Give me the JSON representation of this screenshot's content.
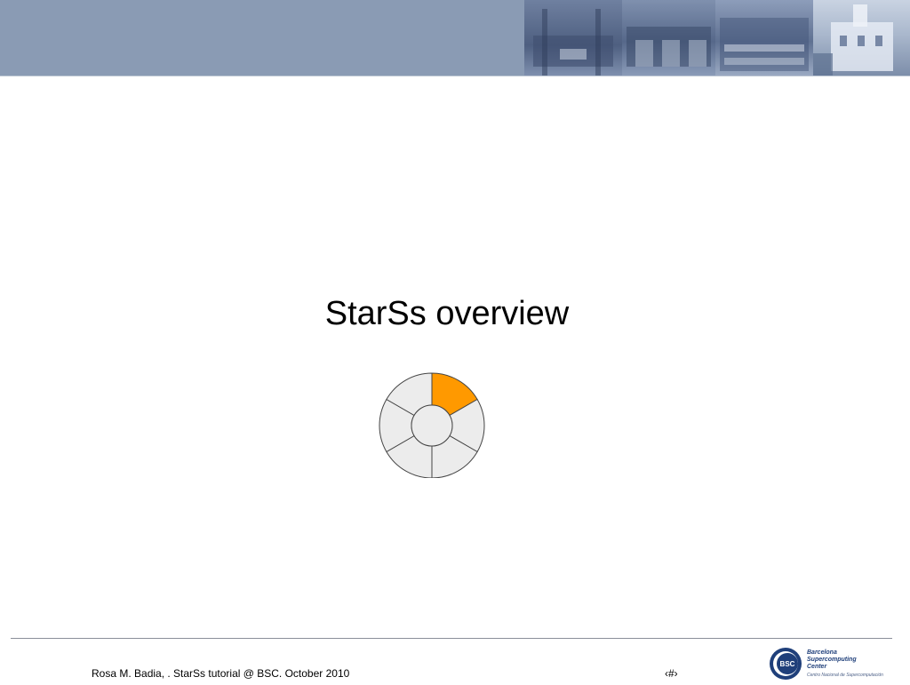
{
  "slide": {
    "title": "StarSs overview",
    "progress": {
      "segments": 6,
      "active_segment": 1,
      "active_color": "#ff9900",
      "inactive_color": "#ececec"
    }
  },
  "header": {
    "band_color": "#8a9bb4"
  },
  "footer": {
    "text": "Rosa M. Badia, . StarSs tutorial @  BSC. October 2010",
    "slide_number": "‹#›",
    "logo": {
      "line1": "Barcelona",
      "line2": "Supercomputing",
      "line3": "Center",
      "subline": "Centro Nacional de Supercomputación",
      "badge": "BSC"
    }
  }
}
